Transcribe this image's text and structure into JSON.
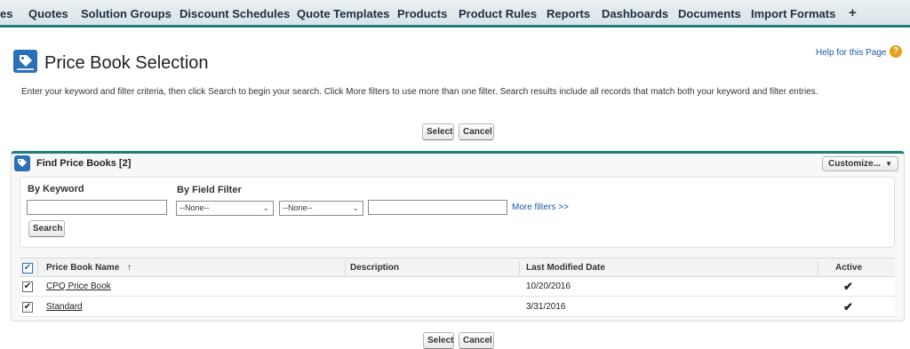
{
  "nav": {
    "tabs": [
      "es",
      "Quotes",
      "Solution Groups",
      "Discount Schedules",
      "Quote Templates",
      "Products",
      "Product Rules",
      "Reports",
      "Dashboards",
      "Documents",
      "Import Formats"
    ],
    "plus": "+"
  },
  "page": {
    "title": "Price Book Selection",
    "help_link": "Help for this Page",
    "help_icon": "?",
    "instructions": "Enter your keyword and filter criteria, then click Search to begin your search. Click More filters to use more than one filter. Search results include all records that match both your keyword and filter entries."
  },
  "buttons": {
    "select": "Select",
    "cancel": "Cancel"
  },
  "find": {
    "title": "Find Price Books [2]",
    "customize": "Customize...",
    "customize_caret": "▼",
    "by_keyword": "By Keyword",
    "by_field_filter": "By Field Filter",
    "keyword_value": "",
    "filter_field": "--None--",
    "filter_operator": "--None--",
    "filter_value": "",
    "more_filters": "More filters >>",
    "search": "Search"
  },
  "table": {
    "columns": [
      "Price Book Name",
      "Description",
      "Last Modified Date",
      "Active"
    ],
    "sort_indicator": "↑",
    "rows": [
      {
        "name": "CPQ Price Book",
        "description": "",
        "modified": "10/20/2016",
        "active": "✔",
        "selected": true
      },
      {
        "name": "Standard",
        "description": "",
        "modified": "3/31/2016",
        "active": "✔",
        "selected": true
      }
    ],
    "header_checkbox": "✔",
    "row_checkbox": "✔"
  },
  "colors": {
    "accent": "#1f7f7a",
    "icon_blue": "#2a6fb8",
    "help_orange": "#e4a11b",
    "link_blue": "#1a58a8"
  }
}
